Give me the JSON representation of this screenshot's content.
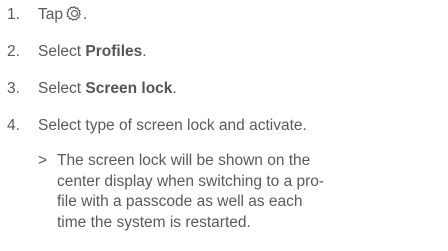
{
  "steps": [
    {
      "number": "1.",
      "text": "Tap",
      "icon": "gear-icon",
      "suffix": "."
    },
    {
      "number": "2.",
      "prefix": "Select ",
      "bold": "Profiles",
      "suffix": "."
    },
    {
      "number": "3.",
      "prefix": "Select ",
      "bold": "Screen lock",
      "suffix": "."
    },
    {
      "number": "4.",
      "text": "Select type of screen lock and activate."
    }
  ],
  "note": {
    "marker": ">",
    "lines": [
      "The screen lock will be shown on the",
      "center display when switching to a pro-",
      "file with a passcode as well as each",
      "time the system is restarted."
    ]
  },
  "colors": {
    "text": "#5a5a5a"
  }
}
